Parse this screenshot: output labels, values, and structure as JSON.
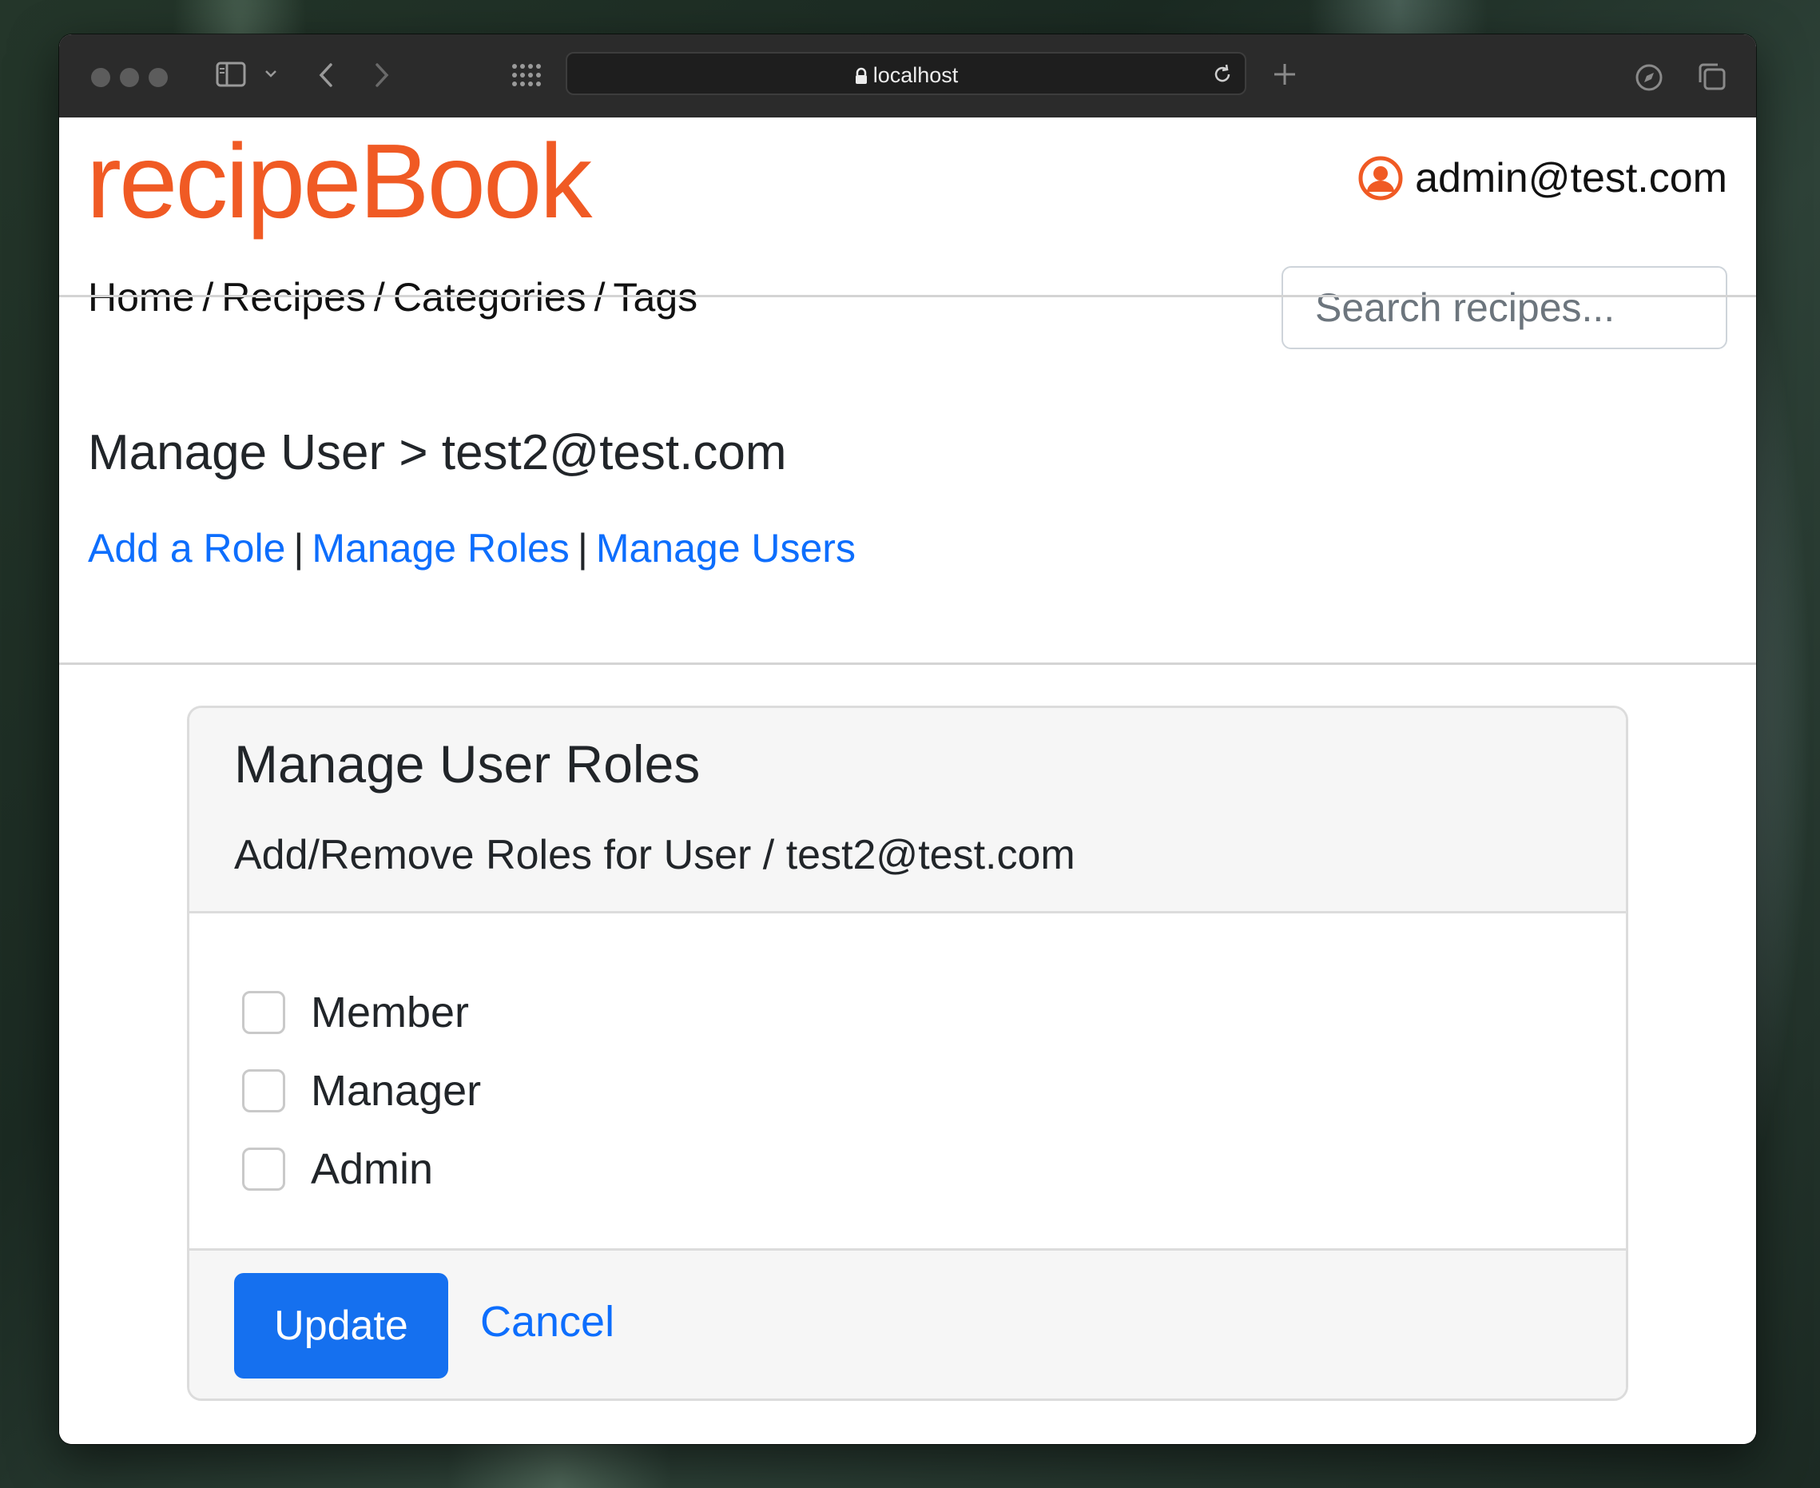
{
  "browser": {
    "url": "localhost",
    "icons": [
      "sidebar-icon",
      "chevron-down-icon",
      "back-icon",
      "forward-icon",
      "grid-icon",
      "lock-icon",
      "reload-icon",
      "plus-icon",
      "compass-icon",
      "tabs-icon"
    ]
  },
  "header": {
    "brand": "recipeBook",
    "user_email": "admin@test.com",
    "nav": [
      "Home",
      "Recipes",
      "Categories",
      "Tags"
    ],
    "nav_separator": "/",
    "search_placeholder": "Search recipes..."
  },
  "page": {
    "title": "Manage User > test2@test.com",
    "links": [
      "Add a Role",
      "Manage Roles",
      "Manage Users"
    ],
    "link_separator": "|"
  },
  "card": {
    "title": "Manage User Roles",
    "subtitle": "Add/Remove Roles for User / test2@test.com",
    "roles": [
      {
        "label": "Member",
        "checked": false
      },
      {
        "label": "Manager",
        "checked": false
      },
      {
        "label": "Admin",
        "checked": false
      }
    ],
    "update_label": "Update",
    "cancel_label": "Cancel"
  },
  "colors": {
    "brand": "#f05a24",
    "link": "#0d6efd",
    "primary_button": "#1570ef"
  }
}
